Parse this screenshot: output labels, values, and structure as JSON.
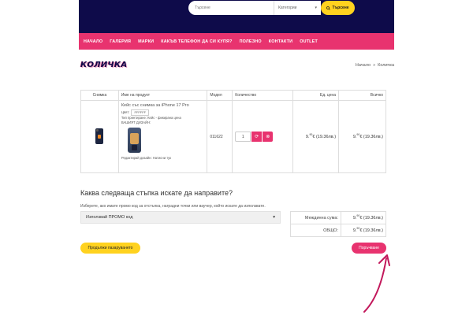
{
  "header": {
    "search_placeholder": "Търсене",
    "category_label": "Категории",
    "search_button": "Търсене"
  },
  "nav": [
    "НАЧАЛО",
    "ГАЛЕРИЯ",
    "МАРКИ",
    "КАКЪВ ТЕЛЕФОН ДА СИ КУПЯ?",
    "ПОЛЕЗНО",
    "КОНТАКТИ",
    "OUTLET"
  ],
  "page": {
    "title": "КОЛИЧКА",
    "breadcrumb": [
      "Начало",
      "»",
      "Количка"
    ]
  },
  "table": {
    "headers": [
      "Снимка",
      "Име на продукт",
      "Модел",
      "Количество",
      "Ед. цена",
      "Всичко"
    ],
    "row": {
      "name": "Кейс със снимка за iPhone 17 Pro",
      "color_label": "Цвят:",
      "color_value": "FFFFFF",
      "type_line": "Тип принтиране: Кейс - фикирана цена",
      "design_line": "ВАШИЯТ ДИЗАЙН:",
      "editor_line": "Редактирай дизайн: Натисни тук",
      "model": "011622",
      "quantity": "1",
      "refresh_glyph": "⟳",
      "remove_glyph": "⊗",
      "unit_int": "9.",
      "unit_dec": "90",
      "unit_rest": "€ (19.36лв.)",
      "total_int": "9.",
      "total_dec": "90",
      "total_rest": "€ (19.36лв.)"
    }
  },
  "next_step": {
    "heading": "Каква следваща стъпка искате да направите?",
    "description": "Изберете, ако имате промо код за отстъпка, наградни точки или ваучер, който искате да използвате.",
    "promo_option": "Използвай ПРОМО код"
  },
  "totals": [
    {
      "label": "Междинна сума:",
      "int": "9.",
      "dec": "90",
      "rest": "€ (19.36лв.)"
    },
    {
      "label": "ОБЩО:",
      "int": "9.",
      "dec": "90",
      "rest": "€ (19.36лв.)"
    }
  ],
  "buttons": {
    "continue": "Продължи пазаруването",
    "checkout": "Поръчване"
  },
  "colors": {
    "header_bg": "#0e0b4a",
    "nav_bg": "#e8336f",
    "accent_yellow": "#ffd21f",
    "annotation_arrow": "#c2185b"
  },
  "icons": {
    "search": "search-icon",
    "dropdown": "caret-down-icon",
    "refresh": "refresh-icon",
    "remove": "remove-icon",
    "annotation": "arrow-annotation-icon"
  }
}
